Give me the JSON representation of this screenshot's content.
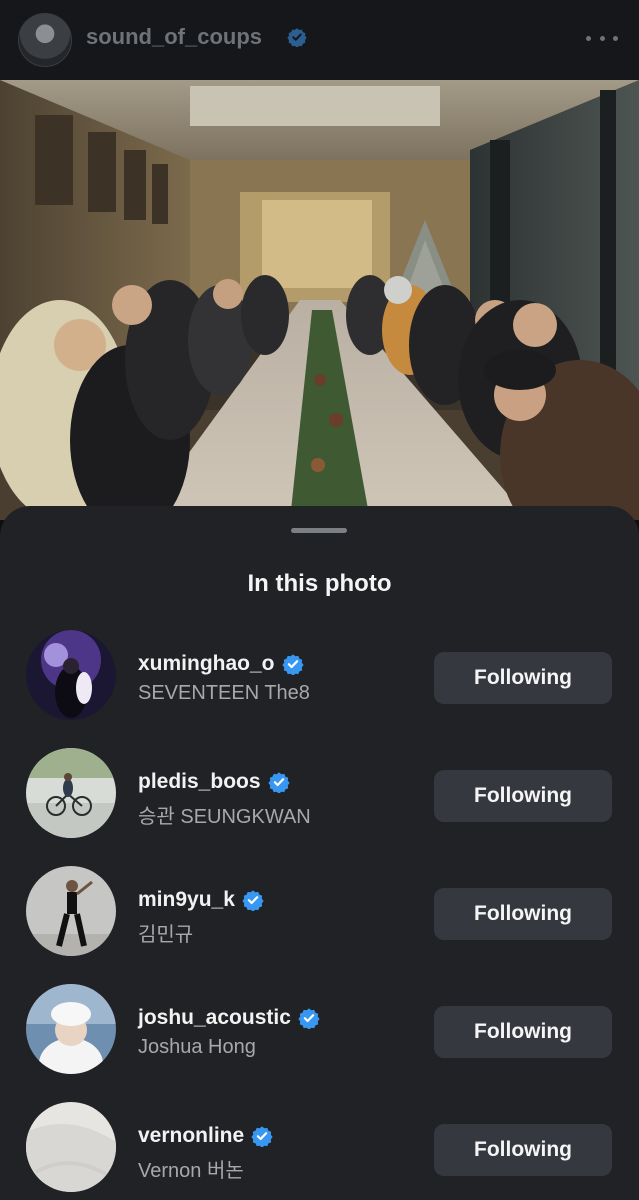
{
  "post_header": {
    "username": "sound_of_coups",
    "verified": true,
    "more_icon": "more-horizontal-icon"
  },
  "sheet": {
    "title": "In this photo"
  },
  "tagged_accounts": [
    {
      "username": "xuminghao_o",
      "full_name": "SEVENTEEN The8",
      "verified": true,
      "button_label": "Following",
      "avatar": "stage-performer-avatar"
    },
    {
      "username": "pledis_boos",
      "full_name": "승관 SEUNGKWAN",
      "verified": true,
      "button_label": "Following",
      "avatar": "bicycle-avatar"
    },
    {
      "username": "min9yu_k",
      "full_name": "김민규",
      "verified": true,
      "button_label": "Following",
      "avatar": "standing-pose-avatar"
    },
    {
      "username": "joshu_acoustic",
      "full_name": "Joshua Hong",
      "verified": true,
      "button_label": "Following",
      "avatar": "white-beanie-avatar"
    },
    {
      "username": "vernonline",
      "full_name": "Vernon 버논",
      "verified": true,
      "button_label": "Following",
      "avatar": "white-fabric-avatar"
    }
  ],
  "colors": {
    "verified_blue": "#3897f0",
    "sheet_background": "#212226",
    "button_background": "#363840"
  }
}
